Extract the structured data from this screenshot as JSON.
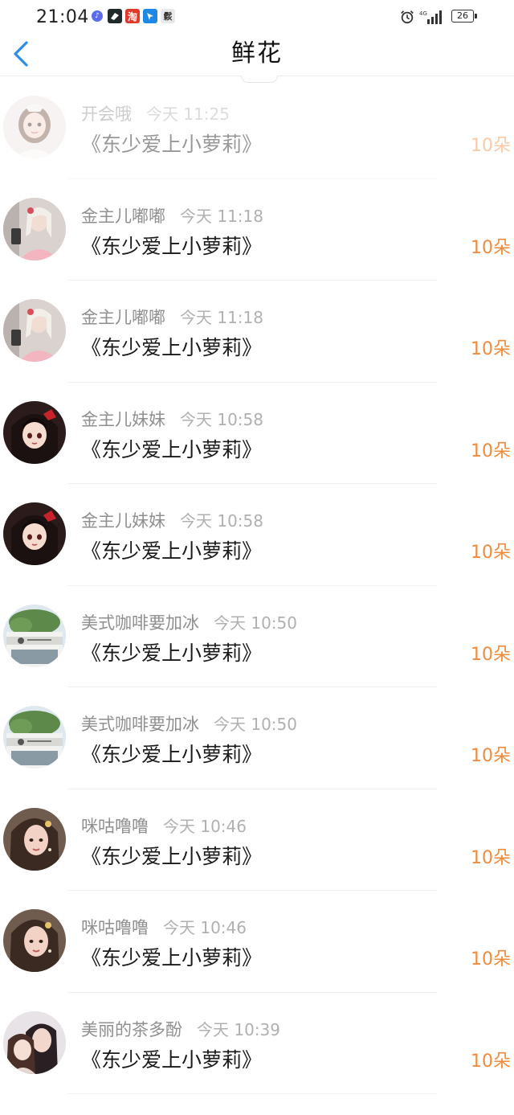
{
  "status_bar": {
    "time": "21:04",
    "app_icons": [
      "music-icon",
      "feishu-icon",
      "taobao-icon",
      "dingtalk-icon",
      "calligraphy-icon"
    ],
    "taobao_label": "淘",
    "calligraphy_label": "鬏",
    "network": "4G",
    "battery": "26"
  },
  "header": {
    "title": "鲜花",
    "back_icon": "chevron-left-icon"
  },
  "colors": {
    "accent": "#2a8fe8",
    "count": "#f08a3c",
    "name": "#8f8f8f",
    "time": "#b0b0b0"
  },
  "items": [
    {
      "name": "开会哦",
      "time": "今天 11:25",
      "title": "《东少爱上小萝莉》",
      "count": "10朵",
      "avatar": "girl-white-dress-avatar",
      "faded": true
    },
    {
      "name": "金主儿嘟嘟",
      "time": "今天 11:18",
      "title": "《东少爱上小萝莉》",
      "count": "10朵",
      "avatar": "pink-outfit-avatar",
      "faded": false
    },
    {
      "name": "金主儿嘟嘟",
      "time": "今天 11:18",
      "title": "《东少爱上小萝莉》",
      "count": "10朵",
      "avatar": "pink-outfit-avatar",
      "faded": false
    },
    {
      "name": "金主儿妹妹",
      "time": "今天 10:58",
      "title": "《东少爱上小萝莉》",
      "count": "10朵",
      "avatar": "anime-girl-red-avatar",
      "faded": false
    },
    {
      "name": "金主儿妹妹",
      "time": "今天 10:58",
      "title": "《东少爱上小萝莉》",
      "count": "10朵",
      "avatar": "anime-girl-red-avatar",
      "faded": false
    },
    {
      "name": "美式咖啡要加冰",
      "time": "今天 10:50",
      "title": "《东少爱上小萝莉》",
      "count": "10朵",
      "avatar": "cafe-storefront-avatar",
      "faded": false
    },
    {
      "name": "美式咖啡要加冰",
      "time": "今天 10:50",
      "title": "《东少爱上小萝莉》",
      "count": "10朵",
      "avatar": "cafe-storefront-avatar",
      "faded": false
    },
    {
      "name": "咪咕噜噜",
      "time": "今天 10:46",
      "title": "《东少爱上小萝莉》",
      "count": "10朵",
      "avatar": "long-hair-woman-avatar",
      "faded": false
    },
    {
      "name": "咪咕噜噜",
      "time": "今天 10:46",
      "title": "《东少爱上小萝莉》",
      "count": "10朵",
      "avatar": "long-hair-woman-avatar",
      "faded": false
    },
    {
      "name": "美丽的茶多酚",
      "time": "今天 10:39",
      "title": "《东少爱上小萝莉》",
      "count": "10朵",
      "avatar": "couple-avatar",
      "faded": false
    }
  ]
}
